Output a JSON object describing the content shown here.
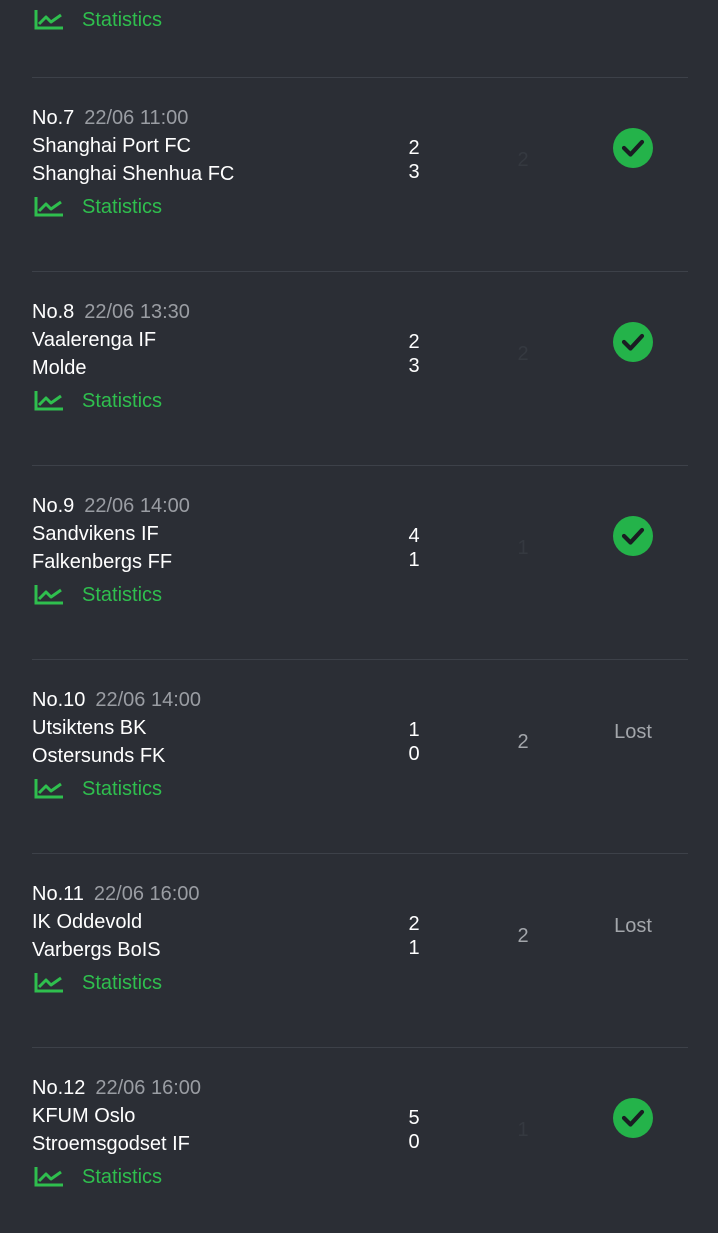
{
  "top_statistics_label": "Statistics",
  "accent_color": "#2fbf4e",
  "matches": [
    {
      "no": "No.7",
      "time": "22/06 11:00",
      "home_team": "Shanghai Port FC",
      "away_team": "Shanghai Shenhua FC",
      "home_score": "2",
      "away_score": "3",
      "pick": "2",
      "result": "won",
      "result_label": "",
      "statistics_label": "Statistics"
    },
    {
      "no": "No.8",
      "time": "22/06 13:30",
      "home_team": "Vaalerenga IF",
      "away_team": "Molde",
      "home_score": "2",
      "away_score": "3",
      "pick": "2",
      "result": "won",
      "result_label": "",
      "statistics_label": "Statistics"
    },
    {
      "no": "No.9",
      "time": "22/06 14:00",
      "home_team": "Sandvikens IF",
      "away_team": "Falkenbergs FF",
      "home_score": "4",
      "away_score": "1",
      "pick": "1",
      "result": "won",
      "result_label": "",
      "statistics_label": "Statistics"
    },
    {
      "no": "No.10",
      "time": "22/06 14:00",
      "home_team": "Utsiktens BK",
      "away_team": "Ostersunds FK",
      "home_score": "1",
      "away_score": "0",
      "pick": "2",
      "result": "lost",
      "result_label": "Lost",
      "statistics_label": "Statistics"
    },
    {
      "no": "No.11",
      "time": "22/06 16:00",
      "home_team": "IK Oddevold",
      "away_team": "Varbergs BoIS",
      "home_score": "2",
      "away_score": "1",
      "pick": "2",
      "result": "lost",
      "result_label": "Lost",
      "statistics_label": "Statistics"
    },
    {
      "no": "No.12",
      "time": "22/06 16:00",
      "home_team": "KFUM Oslo",
      "away_team": "Stroemsgodset IF",
      "home_score": "5",
      "away_score": "0",
      "pick": "1",
      "result": "won",
      "result_label": "",
      "statistics_label": "Statistics"
    }
  ]
}
